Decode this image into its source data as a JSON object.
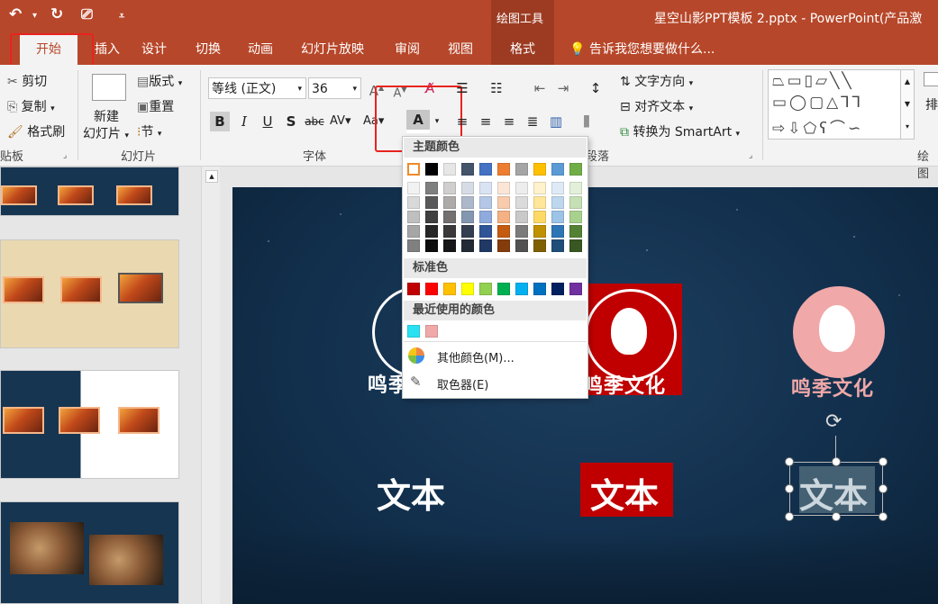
{
  "title_bar": {
    "document_title": "星空山影PPT模板 2.pptx - PowerPoint(产品激",
    "context_group": "绘图工具",
    "context_tab": "格式"
  },
  "tabs": [
    "开始",
    "插入",
    "设计",
    "切换",
    "动画",
    "幻灯片放映",
    "审阅",
    "视图"
  ],
  "tell_me": "告诉我您想要做什么...",
  "clipboard": {
    "cut": "剪切",
    "copy": "复制",
    "format_painter": "格式刷",
    "group": "贴板"
  },
  "slides_group": {
    "new_slide": "新建",
    "new_slide2": "幻灯片",
    "layout": "版式",
    "reset": "重置",
    "section": "节",
    "group": "幻灯片"
  },
  "font_group": {
    "font_name": "等线 (正文)",
    "font_size": "36",
    "group": "字体"
  },
  "paragraph_group": {
    "text_direction": "文字方向",
    "align_text": "对齐文本",
    "smartart": "转换为 SmartArt",
    "group": "段落"
  },
  "drawing_group": {
    "group": "绘图",
    "arrange": "排"
  },
  "color_panel": {
    "theme_colors_title": "主题颜色",
    "standard_colors_title": "标准色",
    "recent_colors_title": "最近使用的颜色",
    "more_colors": "其他颜色(M)...",
    "eyedropper": "取色器(E)",
    "theme_top": [
      "#ffffff",
      "#000000",
      "#e7e6e6",
      "#44546a",
      "#4472c4",
      "#ed7d31",
      "#a5a5a5",
      "#ffc000",
      "#5b9bd5",
      "#70ad47"
    ],
    "theme_shades": [
      [
        "#f2f2f2",
        "#d9d9d9",
        "#bfbfbf",
        "#a6a6a6",
        "#808080"
      ],
      [
        "#7f7f7f",
        "#595959",
        "#404040",
        "#262626",
        "#0d0d0d"
      ],
      [
        "#d0cece",
        "#aeaaaa",
        "#757070",
        "#3a3838",
        "#171616"
      ],
      [
        "#d6dce5",
        "#adb9ca",
        "#8497b0",
        "#333f50",
        "#222a35"
      ],
      [
        "#dae3f3",
        "#b4c7e7",
        "#8faadc",
        "#2f5597",
        "#1f3864"
      ],
      [
        "#fbe5d6",
        "#f8cbad",
        "#f4b183",
        "#c55a11",
        "#843c0c"
      ],
      [
        "#ededed",
        "#dbdbdb",
        "#c9c9c9",
        "#7b7b7b",
        "#525252"
      ],
      [
        "#fff2cc",
        "#ffe699",
        "#ffd966",
        "#bf9000",
        "#7f6000"
      ],
      [
        "#deebf7",
        "#bdd7ee",
        "#9dc3e6",
        "#2e75b6",
        "#1f4e79"
      ],
      [
        "#e2f0d9",
        "#c5e0b4",
        "#a9d18e",
        "#548235",
        "#385723"
      ]
    ],
    "standard": [
      "#c00000",
      "#ff0000",
      "#ffc000",
      "#ffff00",
      "#92d050",
      "#00b050",
      "#00b0f0",
      "#0070c0",
      "#002060",
      "#7030a0"
    ],
    "recent": [
      "#29e1f2",
      "#f0a8a8"
    ]
  },
  "slide": {
    "brand_text": "鸣季文化",
    "brand_text_left": "鸣季",
    "body_text": "文本",
    "colors": {
      "red": "#c00000",
      "pink": "#f0a8a8"
    }
  }
}
